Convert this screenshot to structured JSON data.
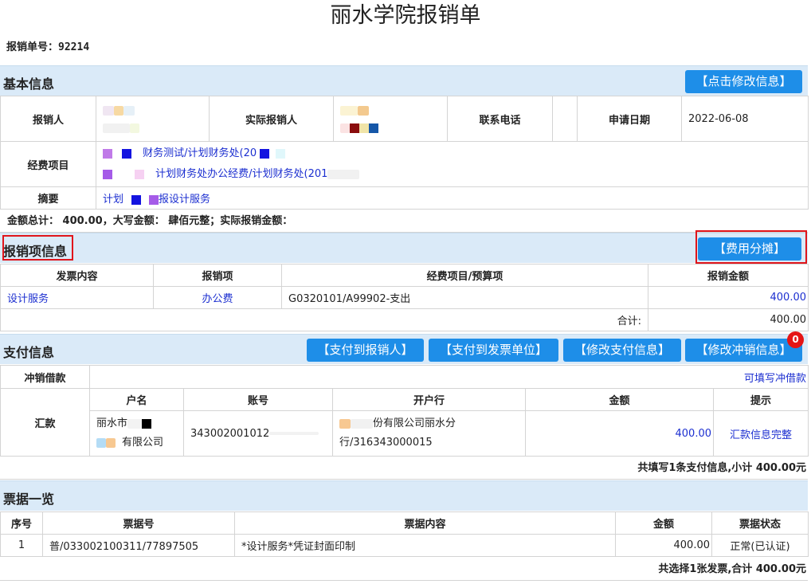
{
  "page": {
    "title": "丽水学院报销单",
    "form_no_label": "报销单号：",
    "form_no": "92214"
  },
  "basic": {
    "header": "基本信息",
    "edit_button": "【点击修改信息】",
    "applicant_label": "报销人",
    "actual_label": "实际报销人",
    "phone_label": "联系电话",
    "date_label": "申请日期",
    "date_value": "2022-06-08",
    "fund_label": "经费项目",
    "fund_items": [
      "财务测试/计划财务处(20",
      "计划财务处办公经费/计划财务处(201"
    ],
    "summary_label": "摘要",
    "summary_value_a": "计划",
    "summary_value_b": "报设计服务",
    "amount_line": "金额总计： 400.00，大写金额： 肆佰元整；实际报销金额："
  },
  "items": {
    "header": "报销项信息",
    "split_button": "【费用分摊】",
    "columns": [
      "发票内容",
      "报销项",
      "经费项目/预算项",
      "报销金额"
    ],
    "rows": [
      {
        "invoice": "设计服务",
        "item": "办公费",
        "fund": "G0320101/A99902-支出",
        "amount": "400.00"
      }
    ],
    "total_label": "合计:",
    "total_value": "400.00"
  },
  "payment": {
    "header": "支付信息",
    "btn_pay_person": "【支付到报销人】",
    "btn_pay_unit": "【支付到发票单位】",
    "btn_edit_pay": "【修改支付信息】",
    "btn_edit_offset": "【修改冲销信息】",
    "offset_badge": "0",
    "offset_label": "冲销借款",
    "offset_link": "可填写冲借款",
    "remit_label": "汇款",
    "columns": [
      "户名",
      "账号",
      "开户行",
      "金额",
      "提示"
    ],
    "row": {
      "name_a": "丽水市",
      "name_b": "有限公司",
      "account": "343002001012",
      "bank_a": "份有限公司丽水分",
      "bank_b": "行/316343000015",
      "amount": "400.00",
      "tip": "汇款信息完整"
    },
    "summary": "共填写1条支付信息,小计 400.00元"
  },
  "bills": {
    "header": "票据一览",
    "columns": [
      "序号",
      "票据号",
      "票据内容",
      "金额",
      "票据状态"
    ],
    "rows": [
      {
        "seq": "1",
        "no": "普/033002100311/77897505",
        "content": "*设计服务*凭证封面印制",
        "amount": "400.00",
        "status": "正常(已认证)"
      }
    ],
    "summary": "共选择1张发票,合计 400.00元"
  }
}
